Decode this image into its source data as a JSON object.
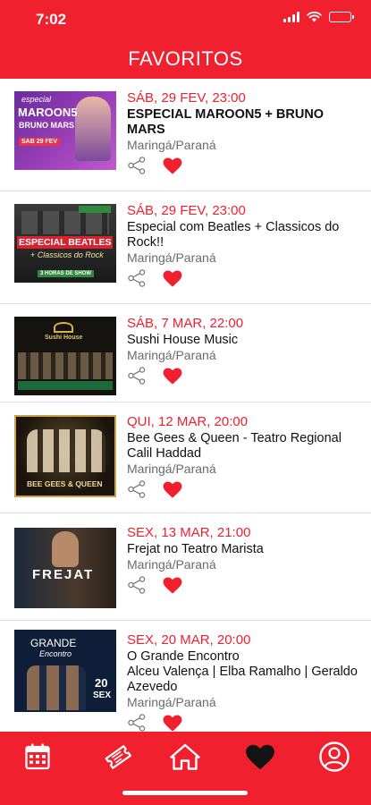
{
  "status_bar": {
    "time": "7:02",
    "battery_level": 0.85
  },
  "header": {
    "title": "FAVORITOS"
  },
  "events": [
    {
      "date": "SÁB, 29 FEV, 23:00",
      "title": "ESPECIAL MAROON5 + BRUNO MARS",
      "location": "Maringá/Paraná",
      "favorited": true
    },
    {
      "date": "SÁB, 29 FEV, 23:00",
      "title": "Especial com Beatles + Classicos do Rock!!",
      "location": "Maringá/Paraná",
      "favorited": true
    },
    {
      "date": "SÁB, 7 MAR, 22:00",
      "title": "Sushi House Music",
      "location": "Maringá/Paraná",
      "favorited": true
    },
    {
      "date": "QUI, 12 MAR, 20:00",
      "title": "Bee Gees & Queen  - Teatro Regional Calil Haddad",
      "location": "Maringá/Paraná",
      "favorited": true
    },
    {
      "date": "SEX, 13 MAR, 21:00",
      "title": "Frejat no Teatro Marista",
      "location": "Maringá/Paraná",
      "favorited": true
    },
    {
      "date": "SEX, 20 MAR, 20:00",
      "title": "O Grande Encontro\nAlceu Valença | Elba Ramalho | Geraldo Azevedo",
      "location": "Maringá/Paraná",
      "favorited": true
    }
  ],
  "thumbnails": [
    {
      "lines": [
        "especial",
        "MAROON5",
        "BRUNO MARS",
        "SAB 29 FEV"
      ]
    },
    {
      "lines": [
        "ESPECIAL BEATLES",
        "+ Classicos do Rock",
        "3 HORAS DE SHOW"
      ]
    },
    {
      "lines": [
        "Sushi House"
      ]
    },
    {
      "lines": [
        "BEE GEES & QUEEN"
      ]
    },
    {
      "lines": [
        "FREJAT"
      ]
    },
    {
      "lines": [
        "GRANDE",
        "Encontro",
        "20",
        "SEX"
      ]
    }
  ],
  "tabbar": {
    "tabs": [
      {
        "icon": "calendar-icon",
        "active": false
      },
      {
        "icon": "ticket-icon",
        "active": false
      },
      {
        "icon": "home-icon",
        "active": false
      },
      {
        "icon": "heart-icon",
        "active": true
      },
      {
        "icon": "profile-icon",
        "active": false
      }
    ]
  },
  "colors": {
    "brand": "#f0202f",
    "text": "#111111",
    "muted": "#6b6b6b",
    "divider": "#e2e2e2"
  }
}
